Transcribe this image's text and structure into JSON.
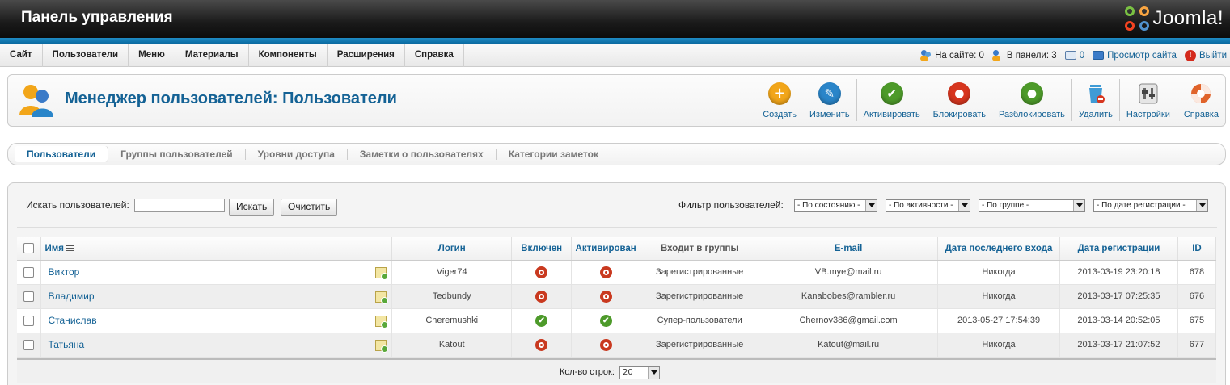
{
  "header": {
    "title": "Панель управления",
    "logo_text": "Joomla!"
  },
  "menu": [
    "Сайт",
    "Пользователи",
    "Меню",
    "Материалы",
    "Компоненты",
    "Расширения",
    "Справка"
  ],
  "status": {
    "on_site": "На сайте: 0",
    "in_panel": "В панели: 3",
    "messages": "0",
    "view_site": "Просмотр сайта",
    "logout": "Выйти"
  },
  "page": {
    "title": "Менеджер пользователей: Пользователи"
  },
  "toolbar": [
    {
      "label": "Создать",
      "icon": "plus-icon",
      "color": "#f2a61a",
      "glyph": "+"
    },
    {
      "label": "Изменить",
      "icon": "pencil-icon",
      "color": "#2a85c9",
      "glyph": "✎"
    },
    {
      "label": "Активировать",
      "icon": "check-icon",
      "color": "#4d9a2a",
      "glyph": "✔"
    },
    {
      "label": "Блокировать",
      "icon": "block-icon",
      "color": "#d7361f",
      "glyph": "●"
    },
    {
      "label": "Разблокировать",
      "icon": "unblock-icon",
      "color": "#4d9a2a",
      "glyph": "●"
    },
    {
      "label": "Удалить",
      "icon": "trash-icon",
      "color": "#3f9bd6",
      "glyph": ""
    },
    {
      "label": "Настройки",
      "icon": "settings-icon",
      "color": "#888888",
      "glyph": ""
    },
    {
      "label": "Справка",
      "icon": "help-lifebuoy-icon",
      "color": "#e0632a",
      "glyph": ""
    }
  ],
  "tabs": [
    "Пользователи",
    "Группы пользователей",
    "Уровни доступа",
    "Заметки о пользователях",
    "Категории заметок"
  ],
  "search": {
    "label": "Искать пользователей:",
    "value": "",
    "search_btn": "Искать",
    "clear_btn": "Очистить"
  },
  "filters": {
    "label": "Фильтр пользователей:",
    "state": "- По состоянию -",
    "active": "- По активности -",
    "group": "- По группе -",
    "date": "- По дате регистрации -"
  },
  "table": {
    "headers": [
      "Имя",
      "Логин",
      "Включен",
      "Активирован",
      "Входит в группы",
      "E-mail",
      "Дата последнего входа",
      "Дата регистрации",
      "ID"
    ],
    "rows": [
      {
        "name": "Виктор",
        "login": "Viger74",
        "enabled": false,
        "activated": false,
        "groups": "Зарегистрированные",
        "email": "VB.mye@mail.ru",
        "last_visit": "Никогда",
        "registered": "2013-03-19 23:20:18",
        "id": "678"
      },
      {
        "name": "Владимир",
        "login": "Tedbundy",
        "enabled": false,
        "activated": false,
        "groups": "Зарегистрированные",
        "email": "Kanabobes@rambler.ru",
        "last_visit": "Никогда",
        "registered": "2013-03-17 07:25:35",
        "id": "676"
      },
      {
        "name": "Станислав",
        "login": "Cheremushki",
        "enabled": true,
        "activated": true,
        "groups": "Супер-пользователи",
        "email": "Chernov386@gmail.com",
        "last_visit": "2013-05-27 17:54:39",
        "registered": "2013-03-14 20:52:05",
        "id": "675"
      },
      {
        "name": "Татьяна",
        "login": "Katout",
        "enabled": false,
        "activated": false,
        "groups": "Зарегистрированные",
        "email": "Katout@mail.ru",
        "last_visit": "Никогда",
        "registered": "2013-03-17 21:07:52",
        "id": "677"
      }
    ]
  },
  "footer": {
    "rows_label": "Кол-во строк:",
    "rows_value": "20"
  }
}
